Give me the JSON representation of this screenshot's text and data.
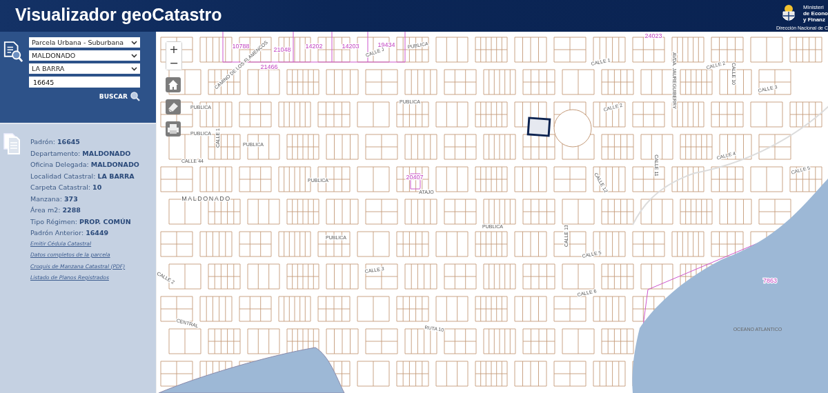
{
  "header": {
    "title": "Visualizador geoCatastro",
    "ministry": [
      "Ministeri",
      "de Econo",
      "y Finanz"
    ],
    "direction": "Dirección Nacional de C"
  },
  "search": {
    "selects": [
      "Parcela Urbana - Suburbana",
      "MALDONADO",
      "LA BARRA"
    ],
    "value": "16645",
    "button": "BUSCAR"
  },
  "details": {
    "fields": [
      {
        "label": "Padrón:",
        "value": "16645"
      },
      {
        "label": "Departamento:",
        "value": "MALDONADO"
      },
      {
        "label": "Oficina Delegada:",
        "value": "MALDONADO"
      },
      {
        "label": "Localidad Catastral:",
        "value": "LA BARRA"
      },
      {
        "label": "Carpeta Catastral:",
        "value": "10"
      },
      {
        "label": "Manzana:",
        "value": "373"
      },
      {
        "label": "Área m2:",
        "value": "2288"
      },
      {
        "label": "Tipo Régimen:",
        "value": "PROP. COMÚN"
      },
      {
        "label": "Padrón Anterior:",
        "value": "16449"
      }
    ],
    "links": [
      "Emitir Cédula Catastral",
      "Datos completos de la parcela",
      "Croquis de Manzana Catastral (PDF)",
      "Listado de Planos Registrados"
    ]
  },
  "map": {
    "zoom_in": "+",
    "zoom_out": "−",
    "labels": [
      {
        "text": "10788",
        "kind": "parcel"
      },
      {
        "text": "21048",
        "kind": "parcel"
      },
      {
        "text": "14202",
        "kind": "parcel"
      },
      {
        "text": "14203",
        "kind": "parcel"
      },
      {
        "text": "19434",
        "kind": "parcel"
      },
      {
        "text": "21466",
        "kind": "parcel"
      },
      {
        "text": "24023",
        "kind": "parcel"
      },
      {
        "text": "20407",
        "kind": "parcel"
      },
      {
        "text": "7863",
        "kind": "parcel"
      },
      {
        "text": "CALLE J",
        "kind": "street"
      },
      {
        "text": "CAMINO DE LOS FLAMENCOS",
        "kind": "street"
      },
      {
        "text": "MALDONADO",
        "kind": "place"
      },
      {
        "text": "OCEANO ATLANTICO",
        "kind": "sea"
      },
      {
        "text": "PUBLICA",
        "kind": "street"
      },
      {
        "text": "PUBLICA",
        "kind": "street"
      },
      {
        "text": "PUBLICA",
        "kind": "street"
      },
      {
        "text": "PUBLICA",
        "kind": "street"
      },
      {
        "text": "PUBLICA",
        "kind": "street"
      },
      {
        "text": "PUBLICA",
        "kind": "street"
      },
      {
        "text": "PUBLICA",
        "kind": "street"
      },
      {
        "text": "PUBLICA",
        "kind": "street"
      },
      {
        "text": "CALLE 44",
        "kind": "street"
      },
      {
        "text": "CALLE 1",
        "kind": "street"
      },
      {
        "text": "CALLE 1",
        "kind": "street"
      },
      {
        "text": "CALLE 2",
        "kind": "street"
      },
      {
        "text": "CALLE 2",
        "kind": "street"
      },
      {
        "text": "CALLE 10",
        "kind": "street"
      },
      {
        "text": "AVDA. JAUREGUIBERRY",
        "kind": "street"
      },
      {
        "text": "CALLE 3",
        "kind": "street"
      },
      {
        "text": "CALLE 4",
        "kind": "street"
      },
      {
        "text": "CALLE 5",
        "kind": "street"
      },
      {
        "text": "CALLE 11",
        "kind": "street"
      },
      {
        "text": "CALLE 12",
        "kind": "street"
      },
      {
        "text": "CALLE 13",
        "kind": "street"
      },
      {
        "text": "CALLE 5",
        "kind": "street"
      },
      {
        "text": "CALLE 6",
        "kind": "street"
      },
      {
        "text": "CALLE 3",
        "kind": "street"
      },
      {
        "text": "RUTA 10",
        "kind": "street"
      },
      {
        "text": "CENTRAL",
        "kind": "street"
      },
      {
        "text": "CALLE 2",
        "kind": "street"
      },
      {
        "text": "ATAJO",
        "kind": "street"
      }
    ]
  }
}
